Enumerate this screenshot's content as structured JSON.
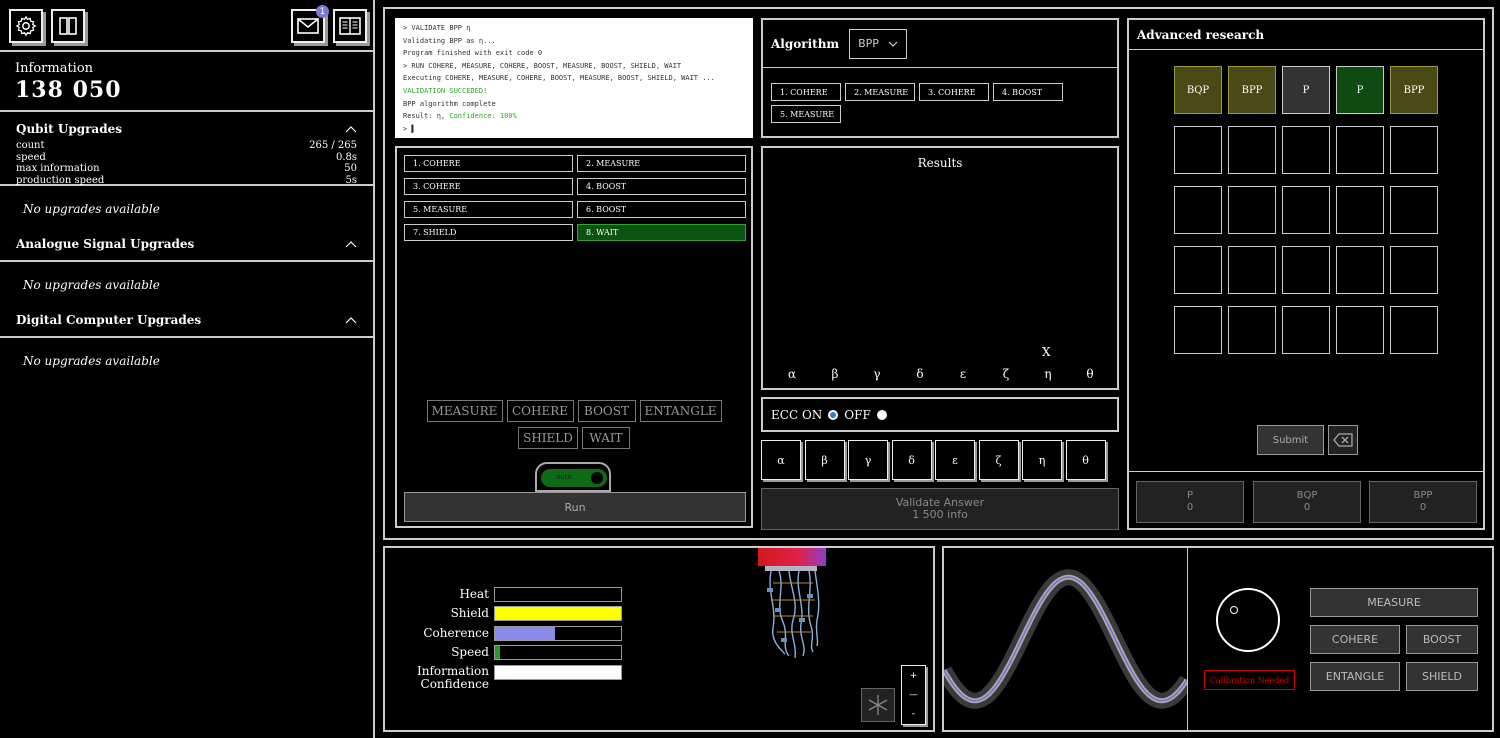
{
  "toolbar": {
    "notification_count": "1"
  },
  "information": {
    "label": "Information",
    "value": "138 050"
  },
  "qubit_upgrades": {
    "title": "Qubit Upgrades",
    "stats": [
      {
        "label": "count",
        "value": "265 / 265"
      },
      {
        "label": "speed",
        "value": "0.8s"
      },
      {
        "label": "max information",
        "value": "50"
      },
      {
        "label": "production speed",
        "value": "5s"
      }
    ],
    "empty_text": "No upgrades available"
  },
  "analogue_upgrades": {
    "title": "Analogue Signal Upgrades",
    "empty_text": "No upgrades available"
  },
  "digital_upgrades": {
    "title": "Digital Computer Upgrades",
    "empty_text": "No upgrades available"
  },
  "console": {
    "lines": [
      {
        "text": "> VALIDATE BPP η",
        "green": false
      },
      {
        "text": "Validating BPP as η...",
        "green": false
      },
      {
        "text": "Program finished with exit code 0",
        "green": false
      },
      {
        "text": "> RUN COHERE, MEASURE, COHERE, BOOST, MEASURE, BOOST, SHIELD, WAIT",
        "green": false
      },
      {
        "text": "Executing COHERE, MEASURE, COHERE, BOOST, MEASURE, BOOST, SHIELD, WAIT ...",
        "green": false
      },
      {
        "text": "VALIDATION SUCCEDED!",
        "green": true
      },
      {
        "text": "BPP algorithm complete",
        "green": false
      }
    ],
    "result_prefix": "Result: η, ",
    "result_confidence": "Confidence: 100%",
    "prompt": "> ▌"
  },
  "program": {
    "steps": [
      "1. COHERE",
      "2. MEASURE",
      "3. COHERE",
      "4. BOOST",
      "5. MEASURE",
      "6. BOOST",
      "7. SHIELD",
      "8. WAIT"
    ],
    "active_step_index": 7,
    "commands_row1": [
      "MEASURE",
      "COHERE",
      "BOOST",
      "ENTANGLE"
    ],
    "commands_row2": [
      "SHIELD",
      "WAIT"
    ],
    "auto_label": "auto",
    "run_label": "Run"
  },
  "algorithm": {
    "label": "Algorithm",
    "selected": "BPP",
    "steps": [
      "1. COHERE",
      "2. MEASURE",
      "3. COHERE",
      "4. BOOST",
      "5. MEASURE"
    ]
  },
  "results": {
    "title": "Results",
    "axis": [
      "α",
      "β",
      "γ",
      "δ",
      "ε",
      "ζ",
      "η",
      "θ"
    ],
    "marker": "X",
    "marker_index": 6
  },
  "ecc": {
    "on_label": "ECC ON",
    "off_label": "OFF",
    "selected": "ON"
  },
  "answers": [
    "α",
    "β",
    "γ",
    "δ",
    "ε",
    "ζ",
    "η",
    "θ"
  ],
  "validate": {
    "label": "Validate Answer",
    "cost": "1 500 info"
  },
  "research": {
    "title": "Advanced research",
    "top_row": [
      {
        "label": "BQP",
        "style": "olive"
      },
      {
        "label": "BPP",
        "style": "olive"
      },
      {
        "label": "P",
        "style": "gray"
      },
      {
        "label": "P",
        "style": "green"
      },
      {
        "label": "BPP",
        "style": "olive"
      }
    ],
    "empty_rows": 4,
    "submit_label": "Submit",
    "totals": [
      {
        "label": "P",
        "value": "0"
      },
      {
        "label": "BQP",
        "value": "0"
      },
      {
        "label": "BPP",
        "value": "0"
      }
    ]
  },
  "hardware": {
    "meters": [
      {
        "label": "Heat",
        "fill": 0.0,
        "color": "#000000"
      },
      {
        "label": "Shield",
        "fill": 1.0,
        "color": "#ffff00"
      },
      {
        "label": "Coherence",
        "fill": 0.48,
        "color": "#8a8ae8"
      },
      {
        "label": "Speed",
        "fill": 0.04,
        "color": "#2a9a2a"
      },
      {
        "label": "Information Confidence",
        "fill": 1.0,
        "color": "#ffffff"
      }
    ],
    "zoom_in": "+",
    "zoom_mid": "—",
    "zoom_out": "-"
  },
  "signal": {
    "calibration_text": "Calibration Needed",
    "buttons": [
      "MEASURE",
      "COHERE",
      "BOOST",
      "ENTANGLE",
      "SHIELD"
    ]
  },
  "colors": {
    "accent": "#7b7bd6",
    "active_green": "#0b5310",
    "warning": "#cc0000"
  },
  "icons": [
    "gear-icon",
    "columns-icon",
    "mail-icon",
    "book-icon",
    "chevron-up-icon",
    "backspace-icon",
    "snowflake-icon"
  ]
}
